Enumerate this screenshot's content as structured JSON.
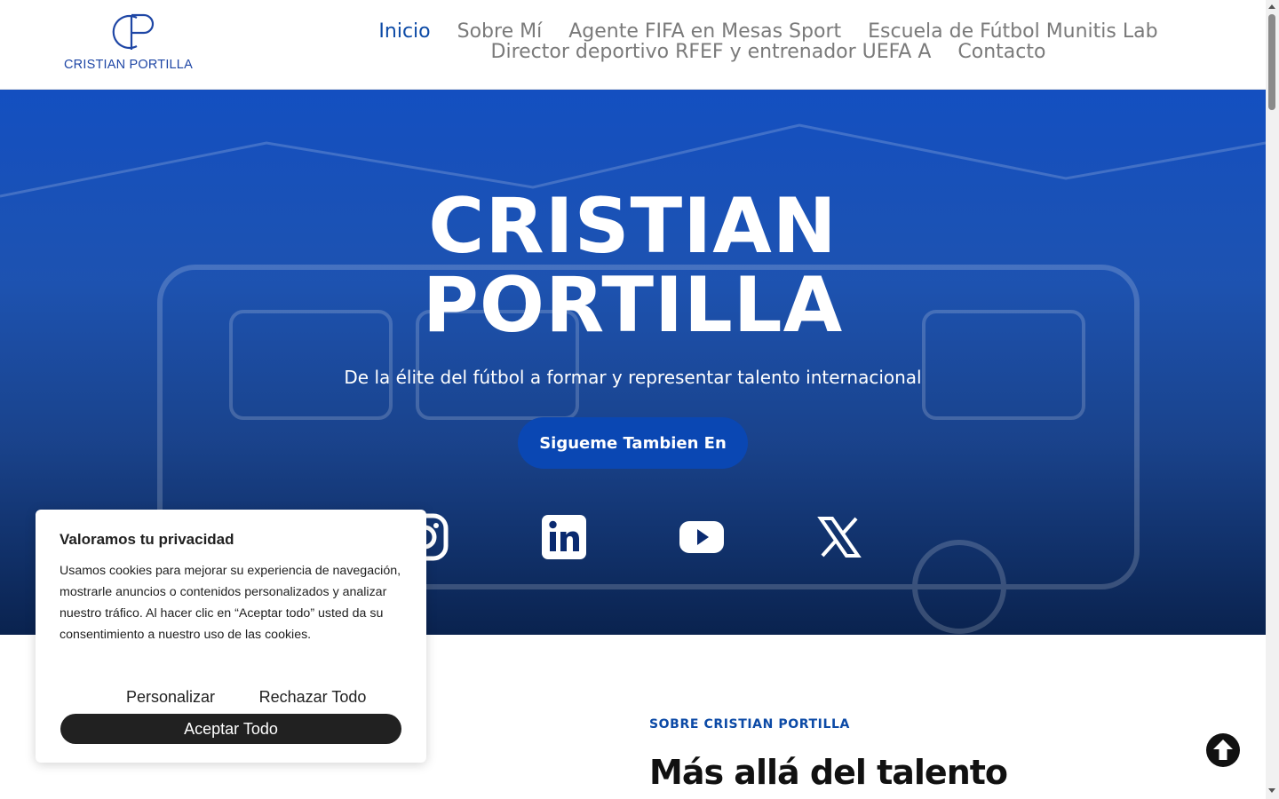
{
  "header": {
    "logo_text": "CRISTIAN PORTILLA",
    "nav": [
      {
        "label": "Inicio",
        "active": true
      },
      {
        "label": "Sobre Mí"
      },
      {
        "label": "Agente FIFA en Mesas Sport"
      },
      {
        "label": "Escuela de Fútbol Munitis Lab"
      },
      {
        "label": "Director deportivo RFEF y entrenador UEFA A"
      },
      {
        "label": "Contacto"
      }
    ]
  },
  "hero": {
    "title_line1": "CRISTIAN",
    "title_line2": "PORTILLA",
    "subtitle": "De la élite del fútbol a formar y representar talento internacional",
    "cta_label": "Sigueme Tambien En",
    "social": [
      "instagram-icon",
      "linkedin-icon",
      "youtube-icon",
      "x-icon"
    ]
  },
  "about": {
    "label": "SOBRE CRISTIAN PORTILLA",
    "title": "Más allá del talento"
  },
  "cookie": {
    "title": "Valoramos tu privacidad",
    "text": "Usamos cookies para mejorar su experiencia de navegación, mostrarle anuncios o contenidos personalizados y analizar nuestro tráfico. Al hacer clic en “Aceptar todo” usted da su consentimiento a nuestro uso de las cookies.",
    "customize_label": "Personalizar",
    "reject_label": "Rechazar Todo",
    "accept_label": "Aceptar Todo"
  },
  "colors": {
    "brand_blue": "#0c4aa6",
    "hero_gradient_top": "#0a48be",
    "hero_gradient_bottom": "#051e4b",
    "cookie_accept_bg": "#212121"
  }
}
